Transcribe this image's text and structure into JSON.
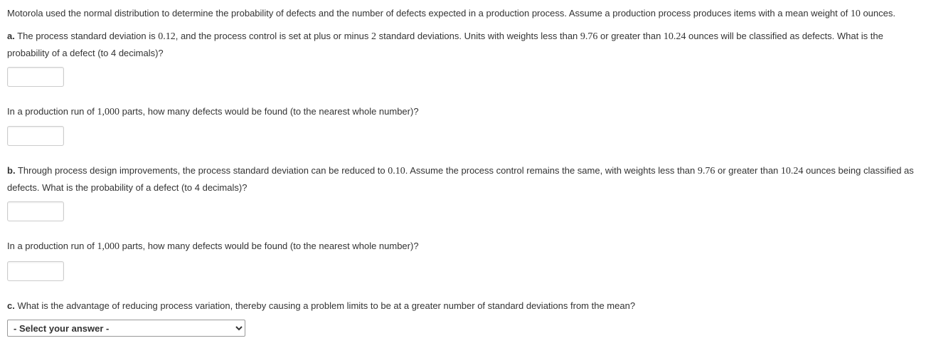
{
  "intro": {
    "text_1": "Motorola used the normal distribution to determine the probability of defects and the number of defects expected in a production process. Assume a production process produces items with a mean weight of ",
    "mean_weight": "10",
    "text_2": " ounces."
  },
  "part_a": {
    "label": "a.",
    "text_1": " The process standard deviation is ",
    "sd": "0.12",
    "text_2": ", and the process control is set at plus or minus ",
    "n_sd": "2",
    "text_3": " standard deviations. Units with weights less than ",
    "lower": "9.76",
    "text_4": " or greater than ",
    "upper": "10.24",
    "text_5": " ounces will be classified as defects. What is the probability of a defect (to 4 decimals)?",
    "followup_1": "In a production run of ",
    "run_n": "1,000",
    "followup_2": " parts, how many defects would be found (to the nearest whole number)?"
  },
  "part_b": {
    "label": "b.",
    "text_1": " Through process design improvements, the process standard deviation can be reduced to ",
    "sd": "0.10",
    "text_2": ". Assume the process control remains the same, with weights less than ",
    "lower": "9.76",
    "text_3": " or greater than ",
    "upper": "10.24",
    "text_4": " ounces being classified as defects. What is the probability of a defect (to 4 decimals)?",
    "followup_1": "In a production run of ",
    "run_n": "1,000",
    "followup_2": " parts, how many defects would be found (to the nearest whole number)?"
  },
  "part_c": {
    "label": "c.",
    "text": " What is the advantage of reducing process variation, thereby causing a problem limits to be at a greater number of standard deviations from the mean?",
    "select_placeholder": "- Select your answer -"
  }
}
